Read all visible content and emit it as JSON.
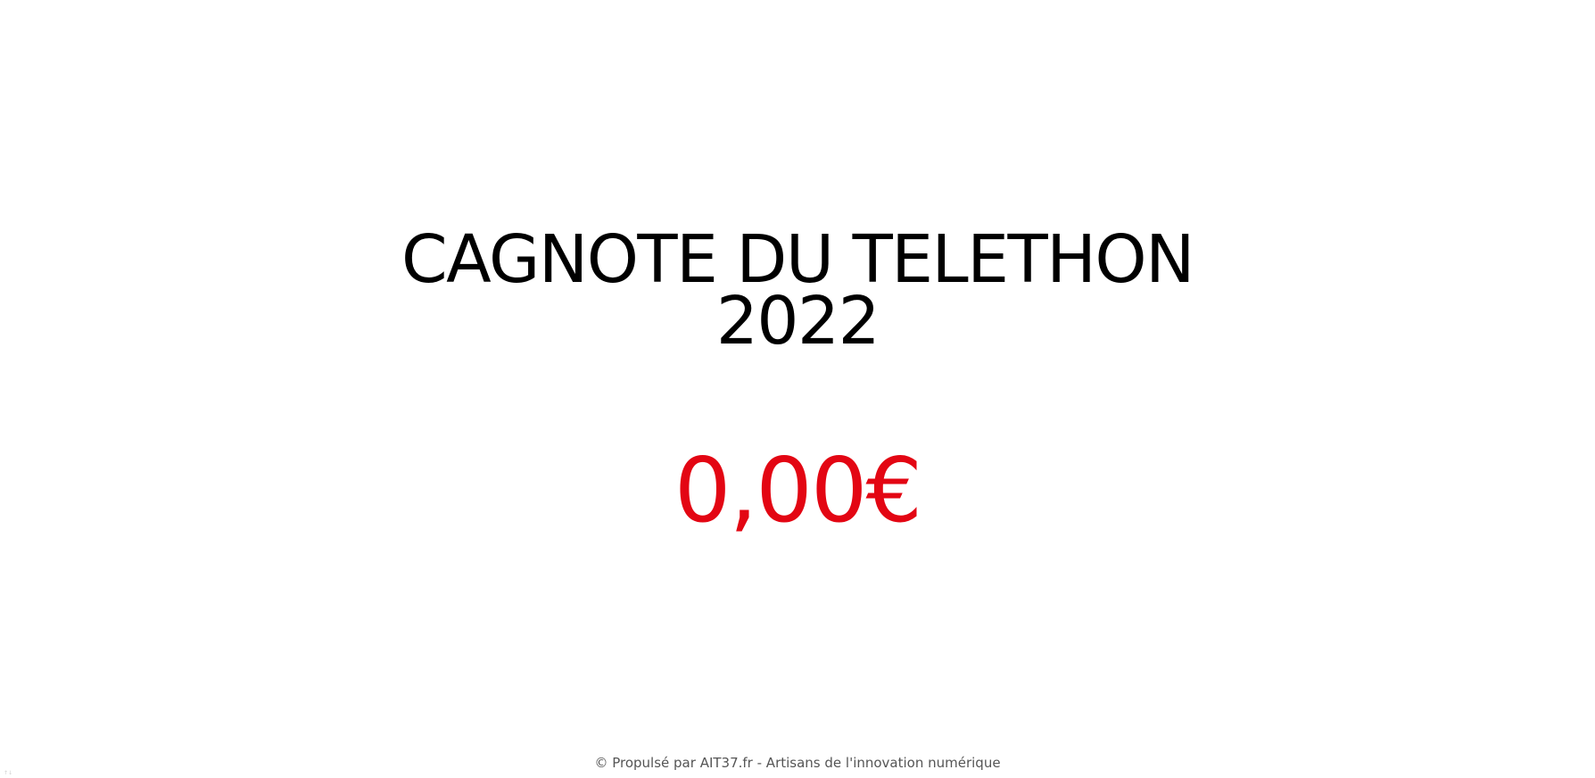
{
  "page": {
    "title_line1": "CAGNOTE DU TELETHON",
    "title_line2": "2022",
    "amount": "0,00€",
    "colors": {
      "title": "#000000",
      "amount": "#e30613",
      "footer": "#555555",
      "background": "#ffffff"
    }
  },
  "footer": {
    "copyright_symbol": "©",
    "prefix": "Propulsé par",
    "link_label": "AIT37.fr",
    "suffix": "- Artisans de l'innovation numérique"
  },
  "corner_mark": "↑↓"
}
